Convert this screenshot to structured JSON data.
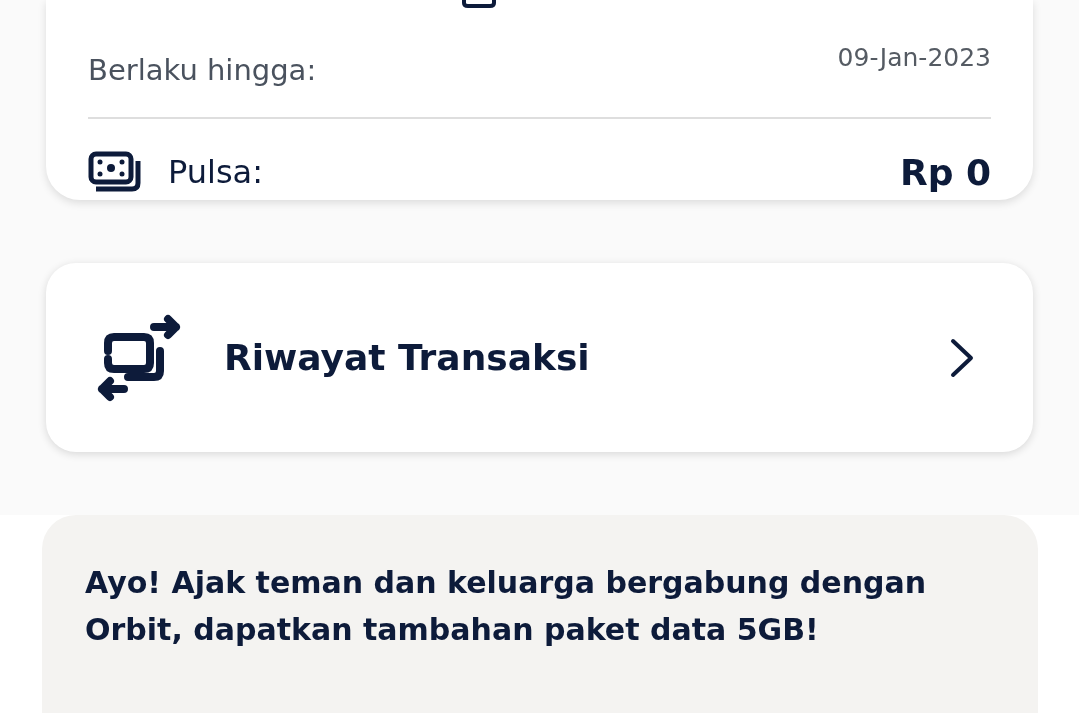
{
  "balance_card": {
    "valid_until_label": "Berlaku hingga:",
    "valid_until_date": "09-Jan-2023",
    "credit_label": "Pulsa:",
    "credit_value": "Rp 0"
  },
  "transaction_history": {
    "label": "Riwayat Transaksi"
  },
  "promo": {
    "text": "Ayo! Ajak teman dan keluarga bergabung dengan Orbit, dapatkan tambahan paket data 5GB!"
  }
}
